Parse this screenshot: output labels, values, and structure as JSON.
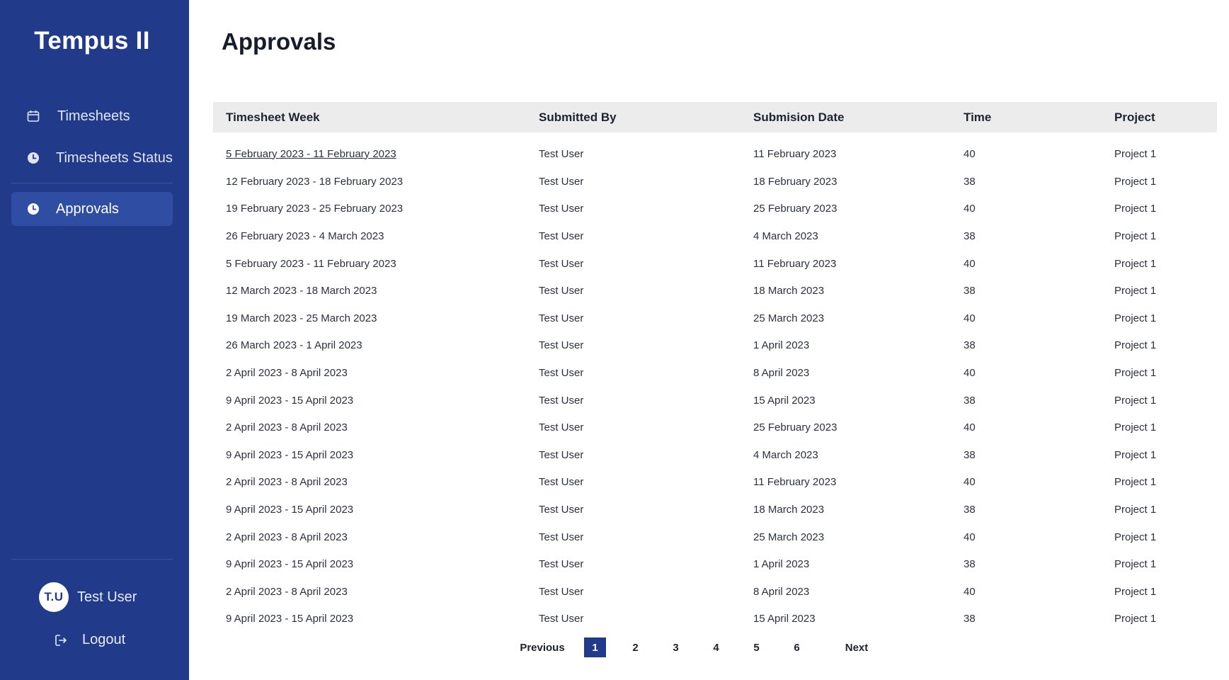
{
  "app": {
    "title": "Tempus II"
  },
  "sidebar": {
    "items": [
      {
        "label": "Timesheets",
        "icon": "calendar-icon"
      },
      {
        "label": "Timesheets Status",
        "icon": "clock-icon"
      },
      {
        "label": "Approvals",
        "icon": "clock-icon",
        "active": true
      }
    ],
    "user": {
      "initials": "T.U",
      "name": "Test User"
    },
    "logout_label": "Logout"
  },
  "main": {
    "title": "Approvals",
    "table": {
      "headers": [
        "Timesheet Week",
        "Submitted By",
        "Submision Date",
        "Time",
        "Project"
      ],
      "rows": [
        [
          "5 February 2023 - 11 February 2023",
          "Test User",
          "11 February 2023",
          "40",
          "Project 1"
        ],
        [
          "12 February 2023 - 18 February 2023",
          "Test User",
          "18 February 2023",
          "38",
          "Project 1"
        ],
        [
          "19 February 2023 - 25 February 2023",
          "Test User",
          "25 February 2023",
          "40",
          "Project 1"
        ],
        [
          "26 February 2023 - 4 March 2023",
          "Test User",
          "4 March 2023",
          "38",
          "Project 1"
        ],
        [
          "5 February 2023 - 11 February 2023",
          "Test User",
          "11 February 2023",
          "40",
          "Project 1"
        ],
        [
          "12 March 2023 - 18 March 2023",
          "Test User",
          "18 March 2023",
          "38",
          "Project 1"
        ],
        [
          "19 March 2023 - 25 March 2023",
          "Test User",
          "25 March 2023",
          "40",
          "Project 1"
        ],
        [
          "26 March 2023 - 1 April 2023",
          "Test User",
          "1 April 2023",
          "38",
          "Project 1"
        ],
        [
          "2 April 2023 - 8 April 2023",
          "Test User",
          "8 April 2023",
          "40",
          "Project 1"
        ],
        [
          "9 April 2023 - 15 April 2023",
          "Test User",
          "15 April 2023",
          "38",
          "Project 1"
        ],
        [
          "2 April 2023 - 8 April 2023",
          "Test User",
          "25 February 2023",
          "40",
          "Project 1"
        ],
        [
          "9 April 2023 - 15 April 2023",
          "Test User",
          "4 March 2023",
          "38",
          "Project 1"
        ],
        [
          "2 April 2023 - 8 April 2023",
          "Test User",
          "11 February 2023",
          "40",
          "Project 1"
        ],
        [
          "9 April 2023 - 15 April 2023",
          "Test User",
          "18 March 2023",
          "38",
          "Project 1"
        ],
        [
          "2 April 2023 - 8 April 2023",
          "Test User",
          "25 March 2023",
          "40",
          "Project 1"
        ],
        [
          "9 April 2023 - 15 April 2023",
          "Test User",
          "1 April 2023",
          "38",
          "Project 1"
        ],
        [
          "2 April 2023 - 8 April 2023",
          "Test User",
          "8 April 2023",
          "40",
          "Project 1"
        ],
        [
          "9 April 2023 - 15 April 2023",
          "Test User",
          "15 April 2023",
          "38",
          "Project 1"
        ]
      ]
    },
    "pagination": {
      "previous_label": "Previous",
      "next_label": "Next",
      "pages": [
        "1",
        "2",
        "3",
        "4",
        "5",
        "6"
      ],
      "current": "1"
    }
  },
  "colors": {
    "sidebar_bg": "#213a8a",
    "active_item_bg": "#2f4ea3",
    "header_bg": "#ececec"
  }
}
